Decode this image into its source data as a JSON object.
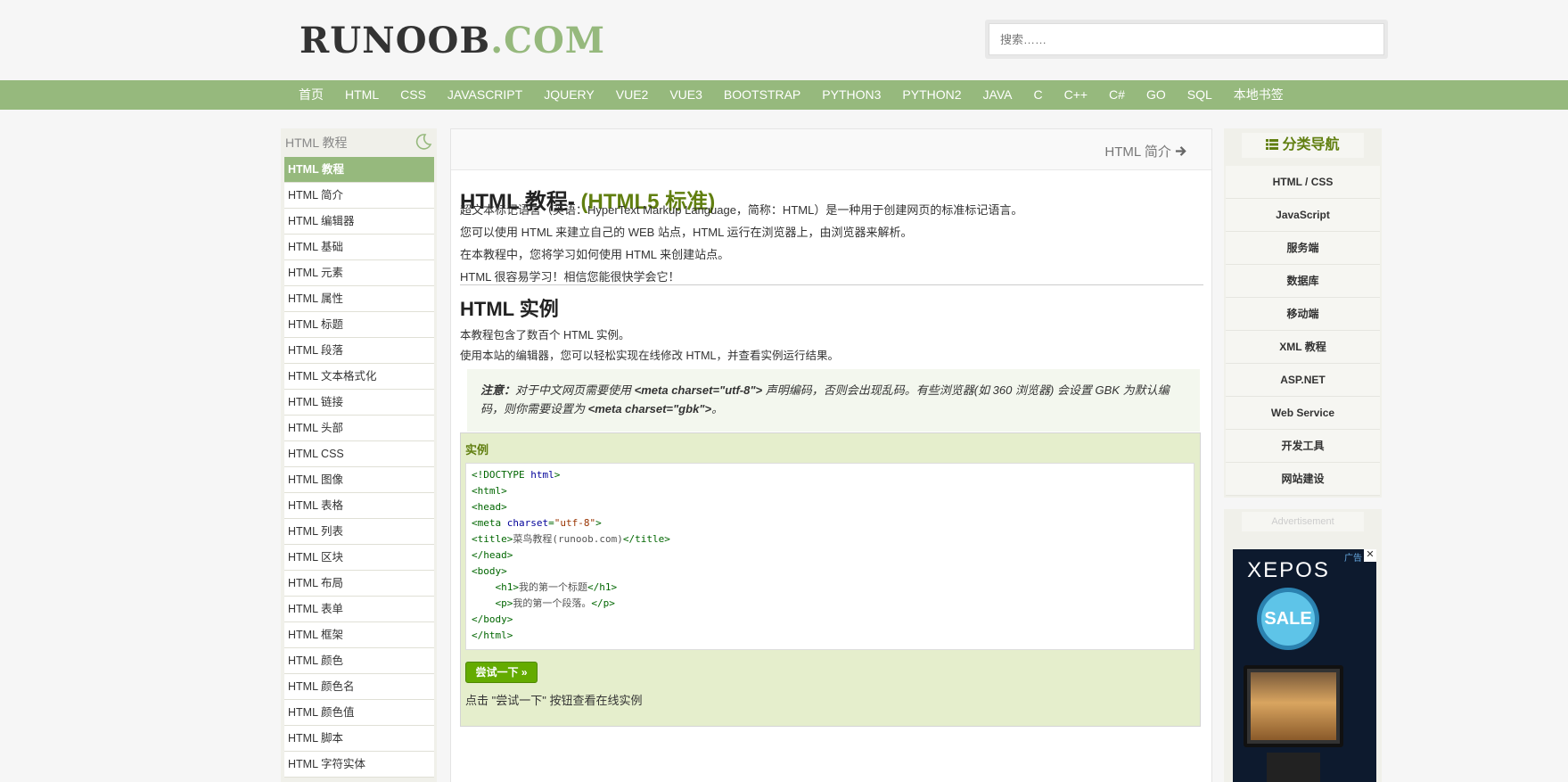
{
  "header": {
    "logo_part1": "RUNOOB",
    "logo_part2": ".COM",
    "search_placeholder": "搜索……"
  },
  "nav": {
    "items": [
      "首页",
      "HTML",
      "CSS",
      "JAVASCRIPT",
      "JQUERY",
      "VUE2",
      "VUE3",
      "BOOTSTRAP",
      "PYTHON3",
      "PYTHON2",
      "JAVA",
      "C",
      "C++",
      "C#",
      "GO",
      "SQL",
      "本地书签"
    ]
  },
  "sidebar": {
    "title": "HTML 教程",
    "items": [
      "HTML 教程",
      "HTML 简介",
      "HTML 编辑器",
      "HTML 基础",
      "HTML 元素",
      "HTML 属性",
      "HTML 标题",
      "HTML 段落",
      "HTML 文本格式化",
      "HTML 链接",
      "HTML 头部",
      "HTML CSS",
      "HTML 图像",
      "HTML 表格",
      "HTML 列表",
      "HTML 区块",
      "HTML 布局",
      "HTML 表单",
      "HTML 框架",
      "HTML 颜色",
      "HTML 颜色名",
      "HTML 颜色值",
      "HTML 脚本",
      "HTML 字符实体"
    ],
    "active_index": 0
  },
  "main": {
    "next_link": "HTML 简介",
    "title_main": "HTML 教程- ",
    "title_accent": "(HTML5 标准)",
    "intro": [
      "超文本标记语言（英语：HyperText Markup Language，简称：HTML）是一种用于创建网页的标准标记语言。",
      "您可以使用 HTML 来建立自己的 WEB 站点，HTML 运行在浏览器上，由浏览器来解析。",
      "在本教程中，您将学习如何使用 HTML 来创建站点。",
      "HTML 很容易学习！相信您能很快学会它！"
    ],
    "section_title": "HTML 实例",
    "section_text": [
      "本教程包含了数百个 HTML 实例。",
      "使用本站的编辑器，您可以轻松实现在线修改 HTML，并查看实例运行结果。"
    ],
    "note": {
      "label": "注意：",
      "text1": "对于中文网页需要使用 ",
      "code1": "<meta charset=\"utf-8\">",
      "text2": " 声明编码，否则会出现乱码。有些浏览器(如 360 浏览器) 会设置 GBK 为默认编码，则你需要设置为 ",
      "code2": "<meta charset=\"gbk\">",
      "text3": "。"
    },
    "example": {
      "title": "实例",
      "try_button": "尝试一下 »",
      "hint": "点击 \"尝试一下\" 按钮查看在线实例"
    }
  },
  "right": {
    "title": "分类导航",
    "items": [
      "HTML / CSS",
      "JavaScript",
      "服务端",
      "数据库",
      "移动端",
      "XML 教程",
      "ASP.NET",
      "Web Service",
      "开发工具",
      "网站建设"
    ],
    "ad_label": "Advertisement",
    "ad": {
      "brand": "XEPOS",
      "tag": "广告",
      "sale": "SALE",
      "close": "✕"
    }
  },
  "colors": {
    "accent": "#96b97d",
    "title_green": "#617f10",
    "try_button": "#64ab00"
  }
}
